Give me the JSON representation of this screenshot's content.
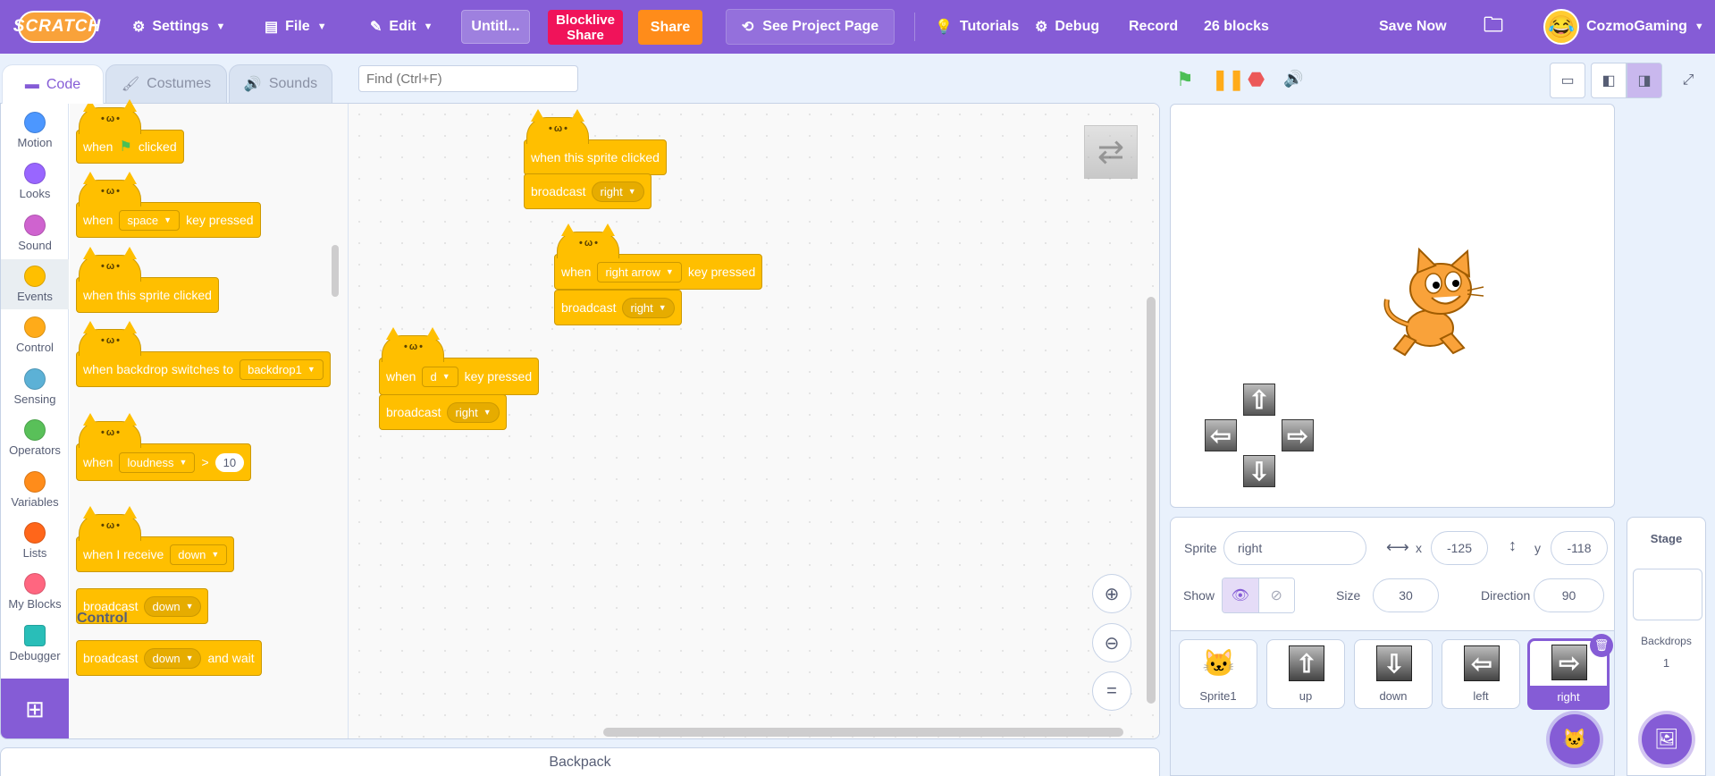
{
  "menubar": {
    "logo": "SCRATCH",
    "settings": "Settings",
    "file": "File",
    "edit": "Edit",
    "project_title": "Untitl...",
    "blocklive_line1": "Blocklive",
    "blocklive_line2": "Share",
    "share": "Share",
    "see_project_page": "See Project Page",
    "tutorials": "Tutorials",
    "debug": "Debug",
    "record": "Record",
    "block_count": "26 blocks",
    "save_now": "Save Now",
    "username": "CozmoGaming"
  },
  "tabs": {
    "code": "Code",
    "costumes": "Costumes",
    "sounds": "Sounds"
  },
  "find": {
    "placeholder": "Find (Ctrl+F)"
  },
  "categories": [
    {
      "label": "Motion",
      "color": "#4c97ff"
    },
    {
      "label": "Looks",
      "color": "#9966ff"
    },
    {
      "label": "Sound",
      "color": "#cf63cf"
    },
    {
      "label": "Events",
      "color": "#ffbf00"
    },
    {
      "label": "Control",
      "color": "#ffab19"
    },
    {
      "label": "Sensing",
      "color": "#5cb1d6"
    },
    {
      "label": "Operators",
      "color": "#59c059"
    },
    {
      "label": "Variables",
      "color": "#ff8c1a"
    },
    {
      "label": "Lists",
      "color": "#ff661a"
    },
    {
      "label": "My Blocks",
      "color": "#ff6680"
    },
    {
      "label": "Debugger",
      "color": "#29beb8"
    }
  ],
  "palette": {
    "when": "when",
    "clicked": "clicked",
    "space": "space",
    "key_pressed": "key pressed",
    "when_sprite_clicked": "when this sprite clicked",
    "when_backdrop_switches": "when backdrop switches to",
    "backdrop1": "backdrop1",
    "loudness": "loudness",
    "gt": ">",
    "loudness_value": "10",
    "when_i_receive": "when I receive",
    "down": "down",
    "broadcast": "broadcast",
    "and_wait": "and wait",
    "section_label": "Control"
  },
  "workspace": {
    "script1": {
      "hat": "when this sprite clicked",
      "broadcast": "broadcast",
      "msg": "right"
    },
    "script2": {
      "when": "when",
      "key": "right arrow",
      "key_pressed": "key pressed",
      "broadcast": "broadcast",
      "msg": "right"
    },
    "script3": {
      "when": "when",
      "key": "d",
      "key_pressed": "key pressed",
      "broadcast": "broadcast",
      "msg": "right"
    }
  },
  "backpack": "Backpack",
  "sprite_info": {
    "sprite_label": "Sprite",
    "sprite_name": "right",
    "x_label": "x",
    "x_value": "-125",
    "y_label": "y",
    "y_value": "-118",
    "show_label": "Show",
    "size_label": "Size",
    "size_value": "30",
    "direction_label": "Direction",
    "direction_value": "90"
  },
  "sprites": [
    {
      "name": "Sprite1"
    },
    {
      "name": "up"
    },
    {
      "name": "down"
    },
    {
      "name": "left"
    },
    {
      "name": "right"
    }
  ],
  "stage_panel": {
    "title": "Stage",
    "backdrops_label": "Backdrops",
    "backdrops_count": "1"
  }
}
